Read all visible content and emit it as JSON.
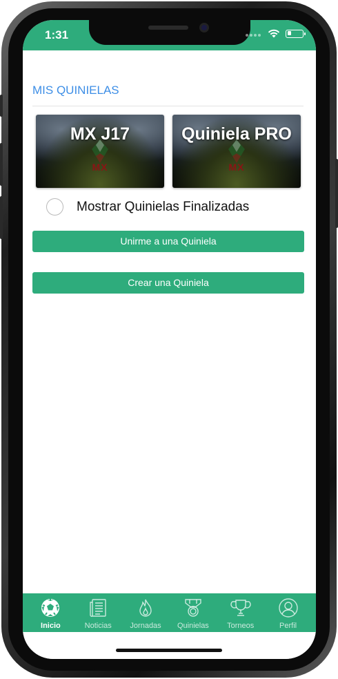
{
  "status_bar": {
    "time": "1:31",
    "battery_level": 0.25
  },
  "page": {
    "section_title": "MIS QUINIELAS"
  },
  "cards": [
    {
      "title": "MX J17",
      "logo_text": "MX"
    },
    {
      "title": "Quiniela PRO",
      "logo_text": "MX"
    }
  ],
  "toggle": {
    "label": "Mostrar Quinielas Finalizadas",
    "checked": false
  },
  "buttons": {
    "join": "Unirme a una Quiniela",
    "create": "Crear una Quiniela"
  },
  "tab_bar": {
    "items": [
      {
        "label": "Inicio",
        "icon": "soccer-ball-icon",
        "active": true
      },
      {
        "label": "Noticias",
        "icon": "newspaper-icon",
        "active": false
      },
      {
        "label": "Jornadas",
        "icon": "flame-icon",
        "active": false
      },
      {
        "label": "Quinielas",
        "icon": "medal-icon",
        "active": false
      },
      {
        "label": "Torneos",
        "icon": "trophy-icon",
        "active": false
      },
      {
        "label": "Perfil",
        "icon": "profile-icon",
        "active": false
      }
    ]
  },
  "colors": {
    "brand_green": "#2eac7c",
    "title_blue": "#3d8ee6",
    "logo_red": "#8a1414"
  }
}
